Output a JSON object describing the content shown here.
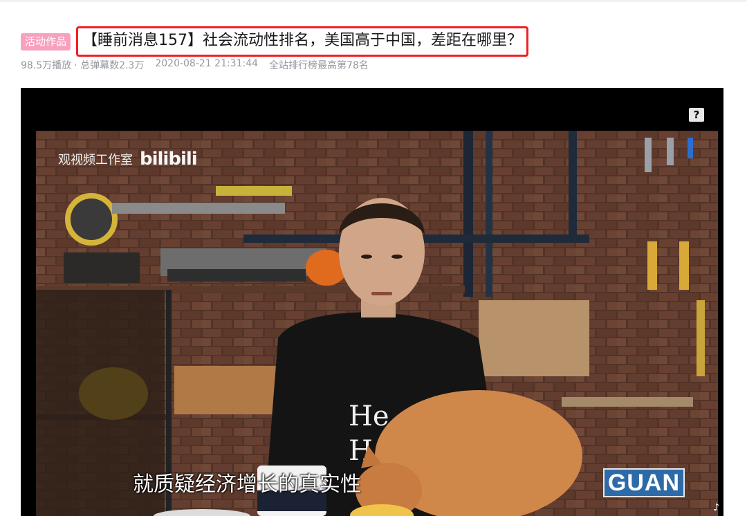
{
  "video": {
    "activity_tag": "活动作品",
    "title": "【睡前消息157】社会流动性排名，美国高于中国，差距在哪里？",
    "views": "98.5万播放",
    "danmaku": "· 总弹幕数2.3万",
    "date": "2020-08-21 21:31:44",
    "rank": "全站排行榜最高第78名"
  },
  "player": {
    "help_icon": "question-icon",
    "help_glyph": "?",
    "studio_watermark": "观视频工作室",
    "site_logo": "bilibili",
    "subtitle": "就质疑经济增长的真实性",
    "channel_logo": "GUAN",
    "corner_glyph": "♪"
  },
  "colors": {
    "title_highlight": "#f01e23",
    "tag_bg": "#f7a1bf",
    "meta_text": "#9499a0"
  }
}
